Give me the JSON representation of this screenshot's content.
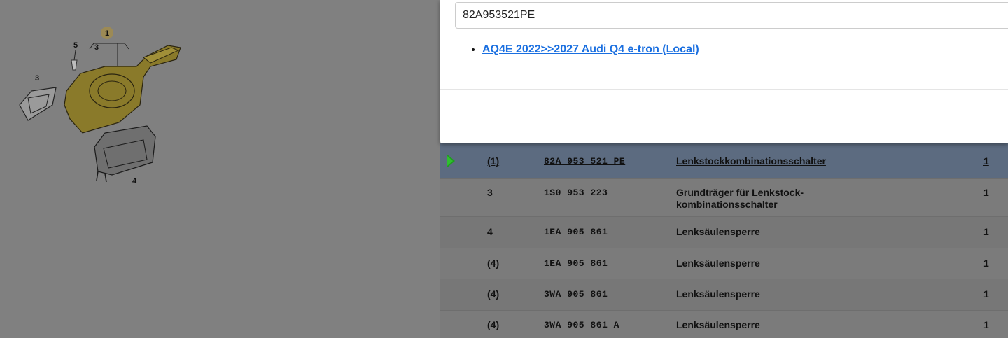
{
  "search": {
    "value": "82A953521PE"
  },
  "results": [
    {
      "label": "AQ4E 2022>>2027 Audi Q4 e-tron (Local)"
    }
  ],
  "diagram": {
    "callouts": [
      "1",
      "3",
      "5",
      "3",
      "4"
    ]
  },
  "parts": {
    "rows": [
      {
        "pos": "(1)",
        "part": "82A 953 521 PE",
        "desc": "Lenkstockkombinationsschalter",
        "qty": "1",
        "selected": true
      },
      {
        "pos": "3",
        "part": "1S0 953 223",
        "desc": "Grundträger für Lenkstock-kombinationsschalter",
        "qty": "1"
      },
      {
        "pos": "4",
        "part": "1EA 905 861",
        "desc": "Lenksäulensperre",
        "qty": "1"
      },
      {
        "pos": "(4)",
        "part": "1EA 905 861",
        "desc": "Lenksäulensperre",
        "qty": "1"
      },
      {
        "pos": "(4)",
        "part": "3WA 905 861",
        "desc": "Lenksäulensperre",
        "qty": "1"
      },
      {
        "pos": "(4)",
        "part": "3WA 905 861 A",
        "desc": "Lenksäulensperre",
        "qty": "1"
      }
    ]
  },
  "colors": {
    "link": "#1a6fe0",
    "selected_row": "#5c6b80",
    "play_icon": "#1e9e1e",
    "highlight_part": "#8a7a2a"
  }
}
